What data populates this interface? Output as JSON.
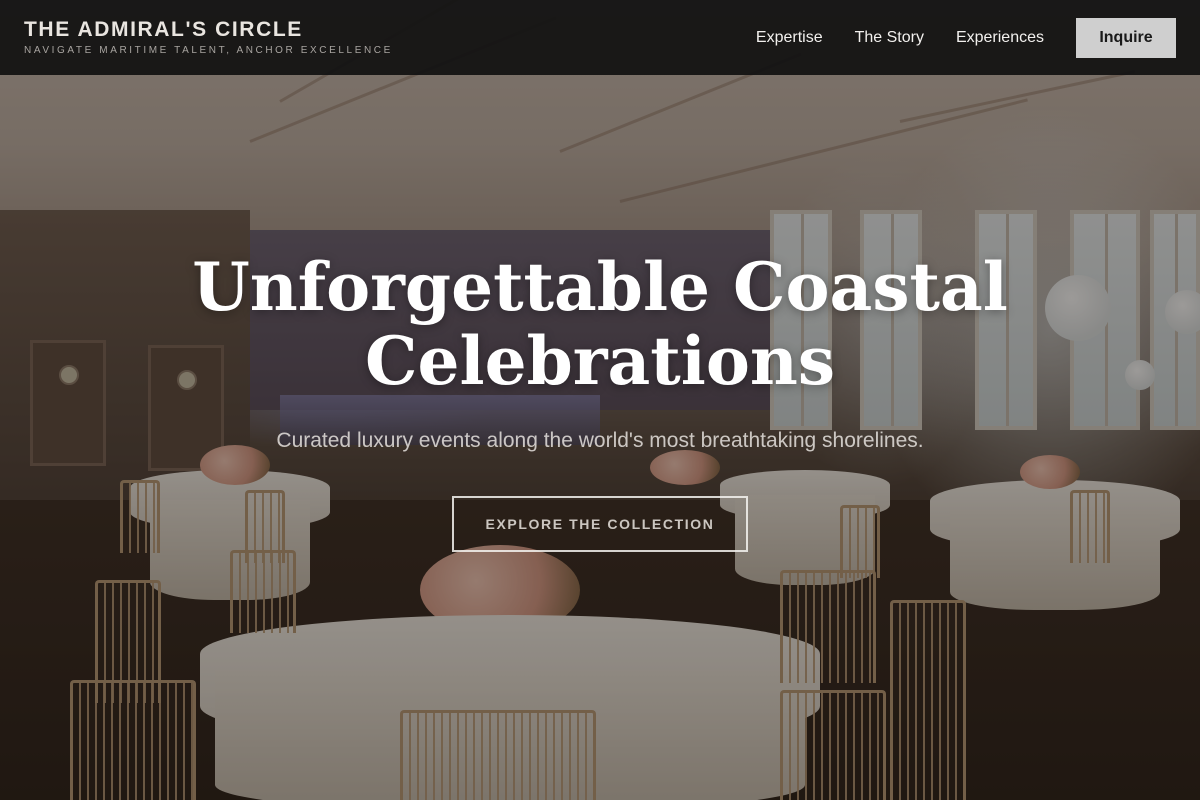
{
  "header": {
    "brand_title": "THE ADMIRAL'S CIRCLE",
    "brand_tagline": "NAVIGATE MARITIME TALENT, ANCHOR EXCELLENCE",
    "nav": [
      {
        "label": "Expertise"
      },
      {
        "label": "The Story"
      },
      {
        "label": "Experiences"
      }
    ],
    "cta_label": "Inquire"
  },
  "hero": {
    "title": "Unforgettable Coastal Celebrations",
    "subtitle": "Curated luxury events along the world's most breathtaking shorelines.",
    "button_label": "EXPLORE THE COLLECTION",
    "background_image": "banquet-hall-photo"
  },
  "colors": {
    "header_bg": "#111111",
    "button_bg": "#cfcfcf",
    "hero_text": "#ffffff"
  }
}
